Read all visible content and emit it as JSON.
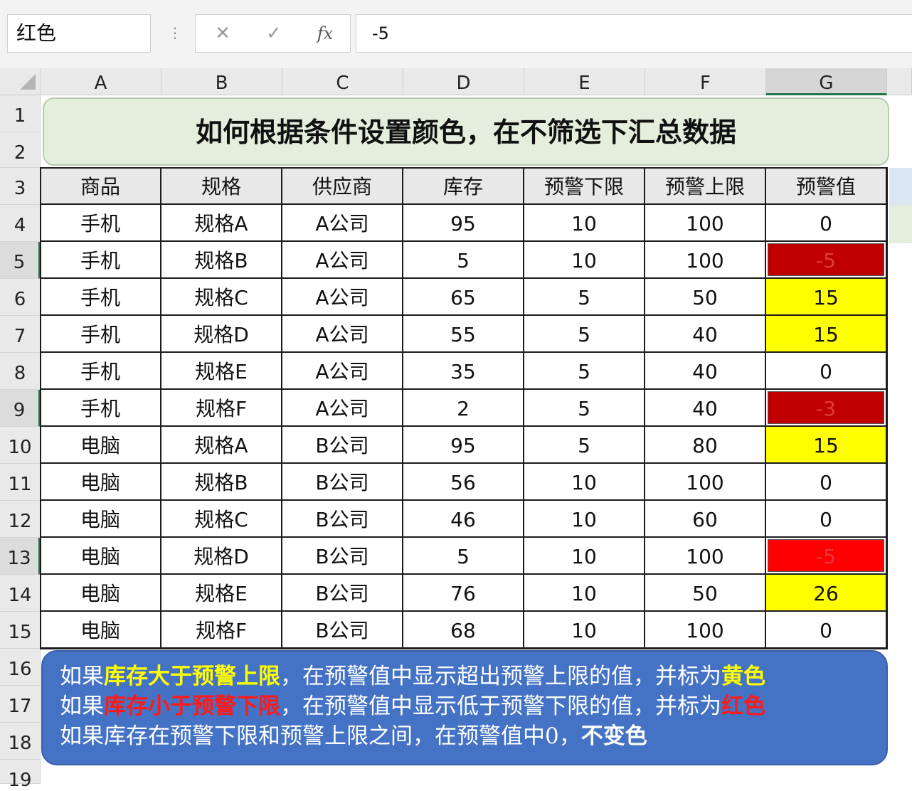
{
  "formula_bar": {
    "name_box": "红色",
    "separator": "⋮",
    "cancel_icon": "✕",
    "confirm_icon": "✓",
    "fx_label": "fx",
    "formula_value": "-5"
  },
  "columns": [
    "A",
    "B",
    "C",
    "D",
    "E",
    "F",
    "G"
  ],
  "selected_column": "G",
  "row_numbers": [
    "1",
    "2",
    "3",
    "4",
    "5",
    "6",
    "7",
    "8",
    "9",
    "10",
    "11",
    "12",
    "13",
    "14",
    "15",
    "16",
    "17",
    "18",
    "19"
  ],
  "title": "如何根据条件设置颜色，在不筛选下汇总数据",
  "table": {
    "headers": [
      "商品",
      "规格",
      "供应商",
      "库存",
      "预警下限",
      "预警上限",
      "预警值"
    ],
    "rows": [
      {
        "cells": [
          "手机",
          "规格A",
          "A公司",
          "95",
          "10",
          "100",
          "0"
        ],
        "warn": "none"
      },
      {
        "cells": [
          "手机",
          "规格B",
          "A公司",
          "5",
          "10",
          "100",
          "-5"
        ],
        "warn": "darkred"
      },
      {
        "cells": [
          "手机",
          "规格C",
          "A公司",
          "65",
          "5",
          "50",
          "15"
        ],
        "warn": "yellow"
      },
      {
        "cells": [
          "手机",
          "规格D",
          "A公司",
          "55",
          "5",
          "40",
          "15"
        ],
        "warn": "yellow"
      },
      {
        "cells": [
          "手机",
          "规格E",
          "A公司",
          "35",
          "5",
          "40",
          "0"
        ],
        "warn": "none"
      },
      {
        "cells": [
          "手机",
          "规格F",
          "A公司",
          "2",
          "5",
          "40",
          "-3"
        ],
        "warn": "darkred"
      },
      {
        "cells": [
          "电脑",
          "规格A",
          "B公司",
          "95",
          "5",
          "80",
          "15"
        ],
        "warn": "yellow"
      },
      {
        "cells": [
          "电脑",
          "规格B",
          "B公司",
          "56",
          "10",
          "100",
          "0"
        ],
        "warn": "none"
      },
      {
        "cells": [
          "电脑",
          "规格C",
          "B公司",
          "46",
          "10",
          "60",
          "0"
        ],
        "warn": "none"
      },
      {
        "cells": [
          "电脑",
          "规格D",
          "B公司",
          "5",
          "10",
          "100",
          "-5"
        ],
        "warn": "red"
      },
      {
        "cells": [
          "电脑",
          "规格E",
          "B公司",
          "76",
          "10",
          "50",
          "26"
        ],
        "warn": "yellow"
      },
      {
        "cells": [
          "电脑",
          "规格F",
          "B公司",
          "68",
          "10",
          "100",
          "0"
        ],
        "warn": "none"
      }
    ]
  },
  "warn_colors": {
    "none": "#ffffff",
    "yellow": "#ffff00",
    "darkred": "#c00000",
    "red": "#ff0000"
  },
  "note": {
    "line1": {
      "a": "如果",
      "b": "库存大于预警上限",
      "c": "，在预警值中显示超出预警上限的值，并标为",
      "d": "黄色"
    },
    "line2": {
      "a": "如果",
      "b": "库存小于预警下限",
      "c": "，在预警值中显示低于预警下限的值，并标为",
      "d": "红色"
    },
    "line3": {
      "a": "如果库存在预警下限和预警上限之间，在预警值中0，",
      "b": "不变色"
    }
  },
  "colors": {
    "title_bg": "#e3efdc",
    "note_bg": "#4472c4",
    "selection_accent": "#217346"
  }
}
